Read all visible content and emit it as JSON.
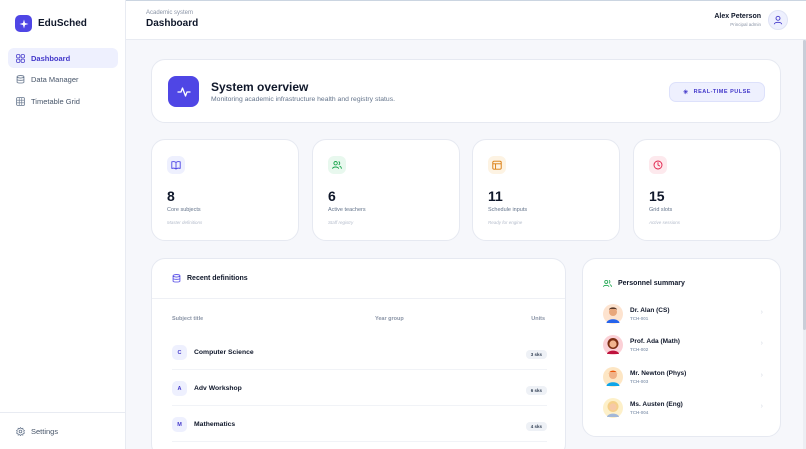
{
  "brand": {
    "name": "EduSched",
    "logo_icon": "sparkle-icon",
    "color": "#4f46e5"
  },
  "sidebar": {
    "items": [
      {
        "label": "Dashboard",
        "icon": "grid-icon",
        "active": true
      },
      {
        "label": "Data Manager",
        "icon": "database-icon",
        "active": false
      },
      {
        "label": "Timetable Grid",
        "icon": "table-icon",
        "active": false
      }
    ],
    "settings_label": "Settings"
  },
  "header": {
    "breadcrumb": "Academic system",
    "title": "Dashboard",
    "user_name": "Alex Peterson",
    "user_role": "Principal admin"
  },
  "overview": {
    "title": "System overview",
    "subtitle": "Monitoring academic infrastructure health and registry status.",
    "pulse_label": "REAL-TIME PULSE"
  },
  "stats": [
    {
      "value": "8",
      "label": "Core subjects",
      "hint": "Master definitions",
      "icon": "book-icon",
      "color": "#4f46e5",
      "bg": "#eef0fe"
    },
    {
      "value": "6",
      "label": "Active teachers",
      "hint": "Staff registry",
      "icon": "users-icon",
      "color": "#16a34a",
      "bg": "#e8f8ee"
    },
    {
      "value": "11",
      "label": "Schedule inputs",
      "hint": "Ready for engine",
      "icon": "calendar-icon",
      "color": "#d97706",
      "bg": "#fdf3e3"
    },
    {
      "value": "15",
      "label": "Grid slots",
      "hint": "Active sessions",
      "icon": "clock-icon",
      "color": "#e11d48",
      "bg": "#fde9ed"
    }
  ],
  "recent": {
    "title": "Recent definitions",
    "columns": [
      "Subject title",
      "Year group",
      "Units"
    ],
    "rows": [
      {
        "badge": "C",
        "name": "Computer Science",
        "units": "3 sks"
      },
      {
        "badge": "A",
        "name": "Adv Workshop",
        "units": "6 sks"
      },
      {
        "badge": "M",
        "name": "Mathematics",
        "units": "4 sks"
      }
    ]
  },
  "personnel": {
    "title": "Personnel summary",
    "people": [
      {
        "name": "Dr. Alan (CS)",
        "code": "TCH-001",
        "avatar_bg": "#fde3cf"
      },
      {
        "name": "Prof. Ada (Math)",
        "code": "TCH-002",
        "avatar_bg": "#fbd0d6"
      },
      {
        "name": "Mr. Newton (Phys)",
        "code": "TCH-003",
        "avatar_bg": "#fde6c4"
      },
      {
        "name": "Ms. Austen (Eng)",
        "code": "TCH-004",
        "avatar_bg": "#fdf0c9"
      }
    ]
  }
}
